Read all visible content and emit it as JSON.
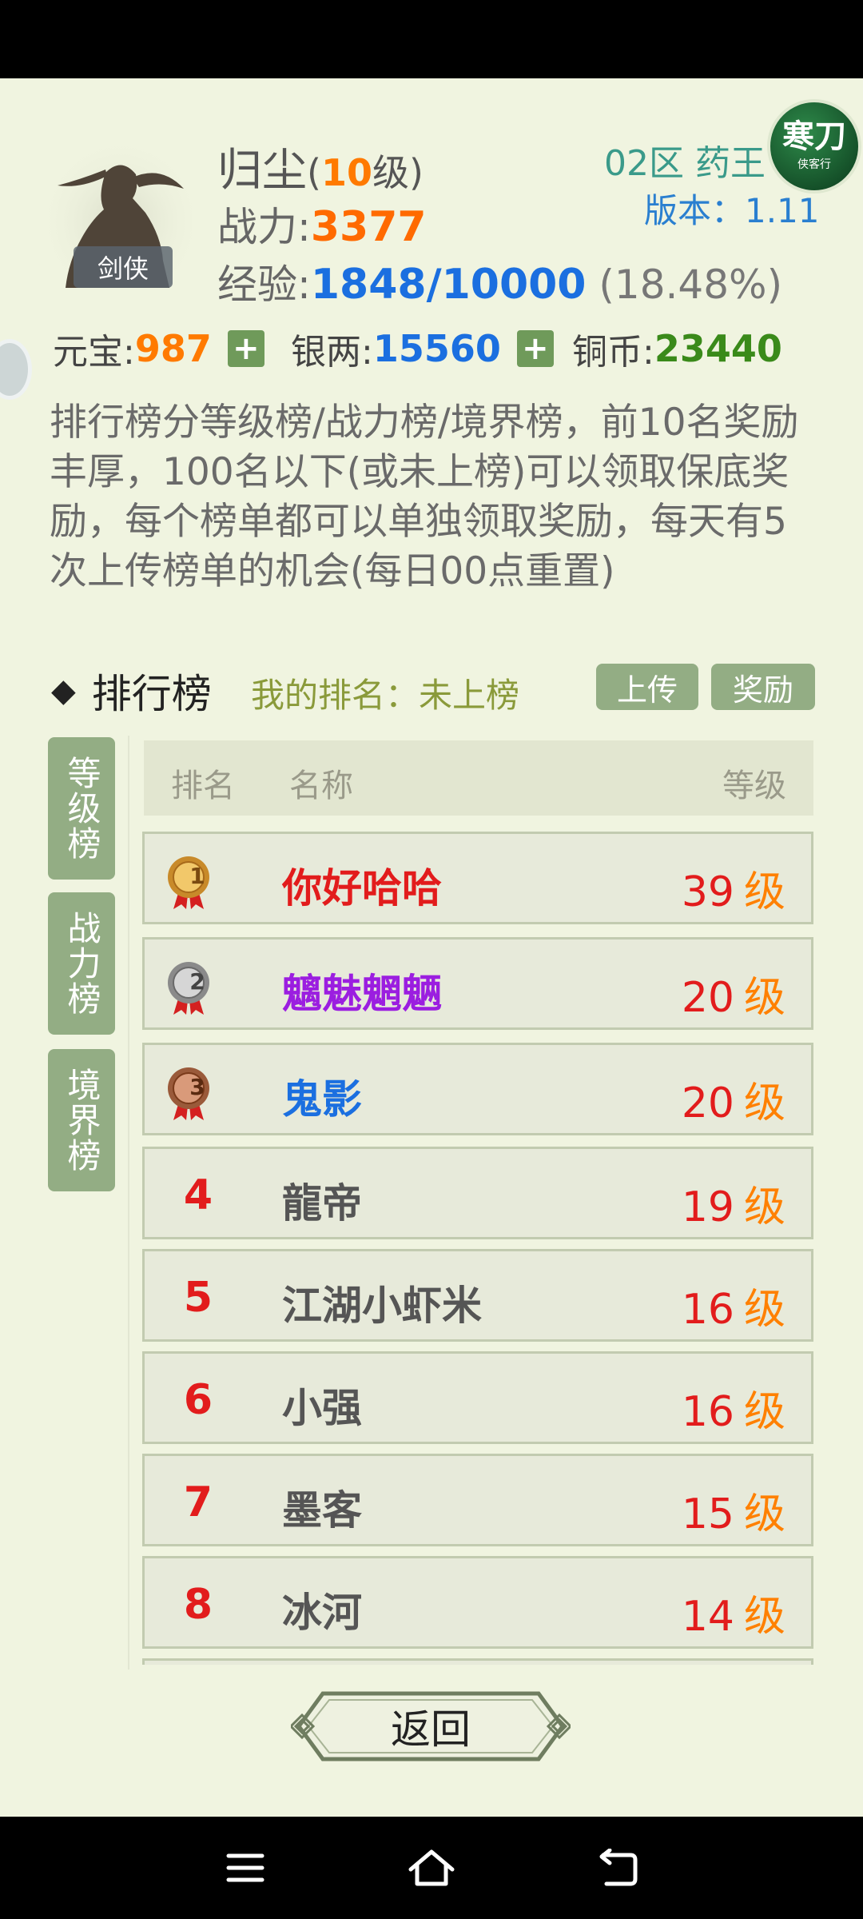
{
  "player": {
    "name": "归尘",
    "level_open": "(",
    "level": "10",
    "level_close": "级)",
    "class": "剑侠",
    "power_label": "战力:",
    "power": "3377",
    "exp_label": "经验:",
    "exp": "1848/10000",
    "exp_pct": "(18.48%)"
  },
  "server": "02区 药王",
  "version": "版本：1.11",
  "logo": {
    "big": "寒刀",
    "small": "侠客行"
  },
  "currency": {
    "yuanbao_label": "元宝:",
    "yuanbao": "987",
    "silver_label": "银两:",
    "silver": "15560",
    "copper_label": "铜币:",
    "copper": "23440",
    "plus": "+"
  },
  "colors": {
    "yuanbao": "#ff7a00",
    "silver": "#1b6fe0",
    "copper": "#3a8a1a",
    "accent_green": "#93ad84"
  },
  "description": "排行榜分等级榜/战力榜/境界榜，前10名奖励丰厚，100名以下(或未上榜)可以领取保底奖励，每个榜单都可以单独领取奖励，每天有5次上传榜单的机会(每日00点重置)",
  "ranking": {
    "title": "排行榜",
    "my_rank": "我的排名：未上榜",
    "upload_label": "上传",
    "reward_label": "奖励",
    "tabs": [
      "等级榜",
      "战力榜",
      "境界榜"
    ],
    "columns": {
      "rank": "排名",
      "name": "名称",
      "level": "等级"
    },
    "level_unit": "级",
    "rows": [
      {
        "rank": "1",
        "name": "你好哈哈",
        "level": "39",
        "name_color": "#e21c1c",
        "medal": "gold"
      },
      {
        "rank": "2",
        "name": "魑魅魍魉",
        "level": "20",
        "name_color": "#9b1ee0",
        "medal": "silver"
      },
      {
        "rank": "3",
        "name": "鬼影",
        "level": "20",
        "name_color": "#1b6fe0",
        "medal": "bronze"
      },
      {
        "rank": "4",
        "name": "龍帝",
        "level": "19",
        "name_color": "#555555"
      },
      {
        "rank": "5",
        "name": "江湖小虾米",
        "level": "16",
        "name_color": "#555555"
      },
      {
        "rank": "6",
        "name": "小强",
        "level": "16",
        "name_color": "#555555"
      },
      {
        "rank": "7",
        "name": "墨客",
        "level": "15",
        "name_color": "#555555"
      },
      {
        "rank": "8",
        "name": "冰河",
        "level": "14",
        "name_color": "#555555"
      }
    ]
  },
  "back_label": "返回"
}
